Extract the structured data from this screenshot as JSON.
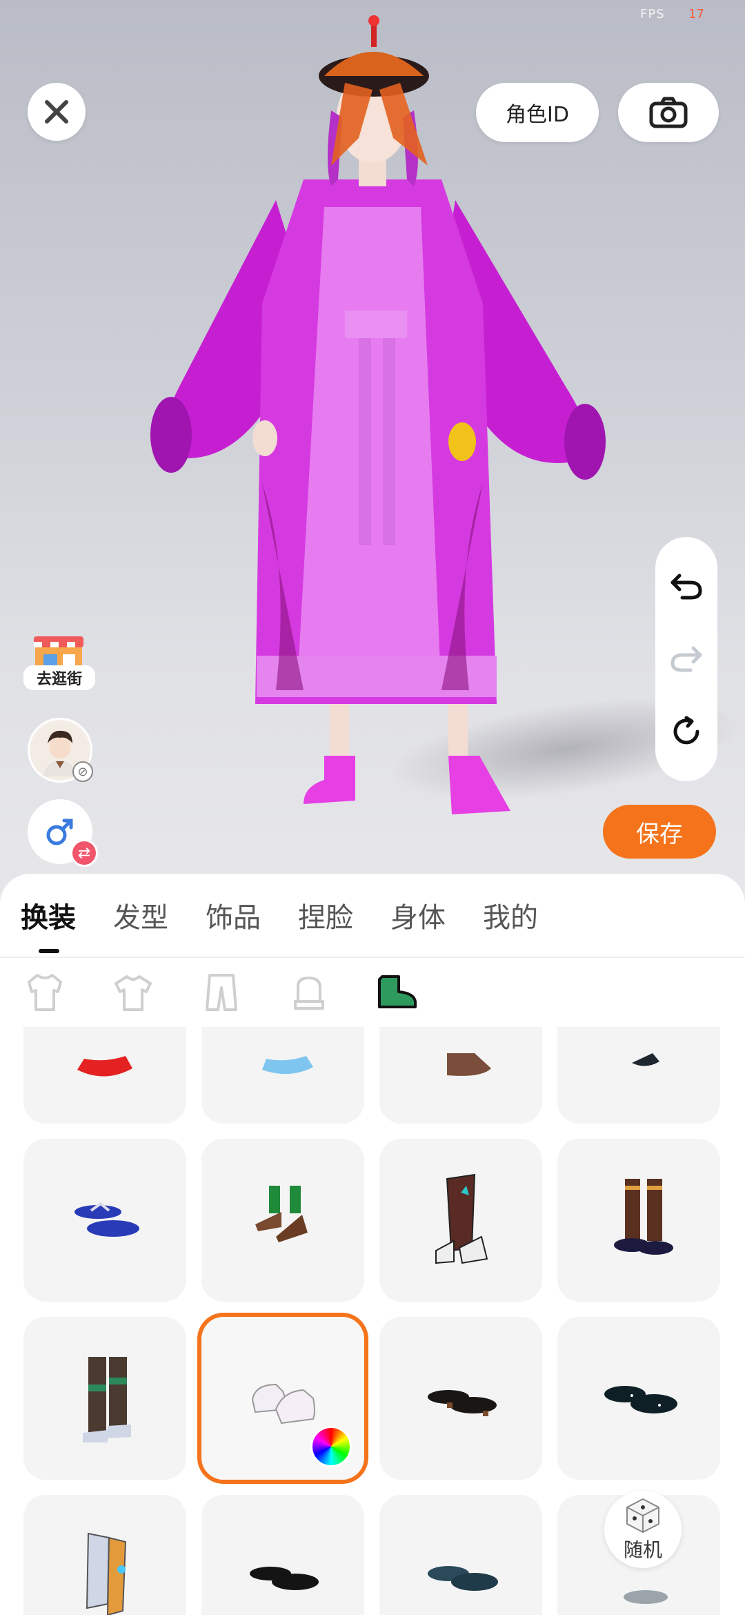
{
  "status": {
    "fps_label": "FPS",
    "fps_value": "17"
  },
  "top_bar": {
    "role_id_label": "角色ID"
  },
  "side": {
    "shop_label": "去逛街"
  },
  "save_label": "保存",
  "tabs": [
    {
      "label": "换装",
      "active": true
    },
    {
      "label": "发型"
    },
    {
      "label": "饰品"
    },
    {
      "label": "捏脸"
    },
    {
      "label": "身体"
    },
    {
      "label": "我的"
    }
  ],
  "subcategories": [
    "suit-icon",
    "top-icon",
    "pants-icon",
    "glove-icon",
    "shoe-icon"
  ],
  "active_subcategory": "shoe-icon",
  "random_label": "随机",
  "colors": {
    "accent": "#f5731a",
    "active_icon": "#2e9a5e"
  }
}
